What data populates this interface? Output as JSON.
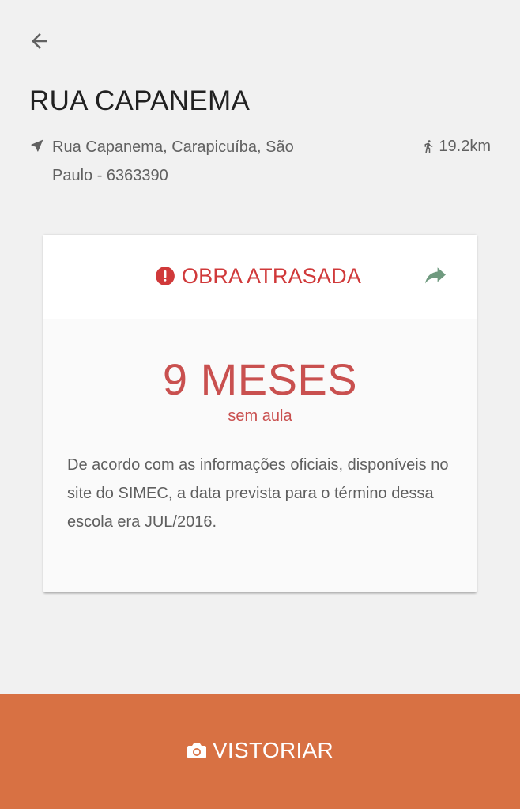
{
  "header": {
    "back_icon": "arrow-left-icon",
    "title": "RUA CAPANEMA"
  },
  "location": {
    "icon": "navigation-arrow-icon",
    "address": "Rua Capanema, Carapicuíba, São Paulo - 6363390",
    "distance_icon": "walking-person-icon",
    "distance": "19.2km"
  },
  "card": {
    "status_icon": "alert-circle-icon",
    "status_label": "OBRA ATRASADA",
    "status_color": "#d0393a",
    "share_icon": "share-arrow-icon",
    "share_color": "#6f9a7f",
    "months_value": "9 MESES",
    "months_caption": "sem aula",
    "accent_color": "#c9504f",
    "description": "De acordo com as informações oficiais, disponíveis no site do SIMEC, a data prevista para o término dessa escola era JUL/2016."
  },
  "action": {
    "icon": "camera-icon",
    "label": "VISTORIAR",
    "background": "#d87143"
  }
}
